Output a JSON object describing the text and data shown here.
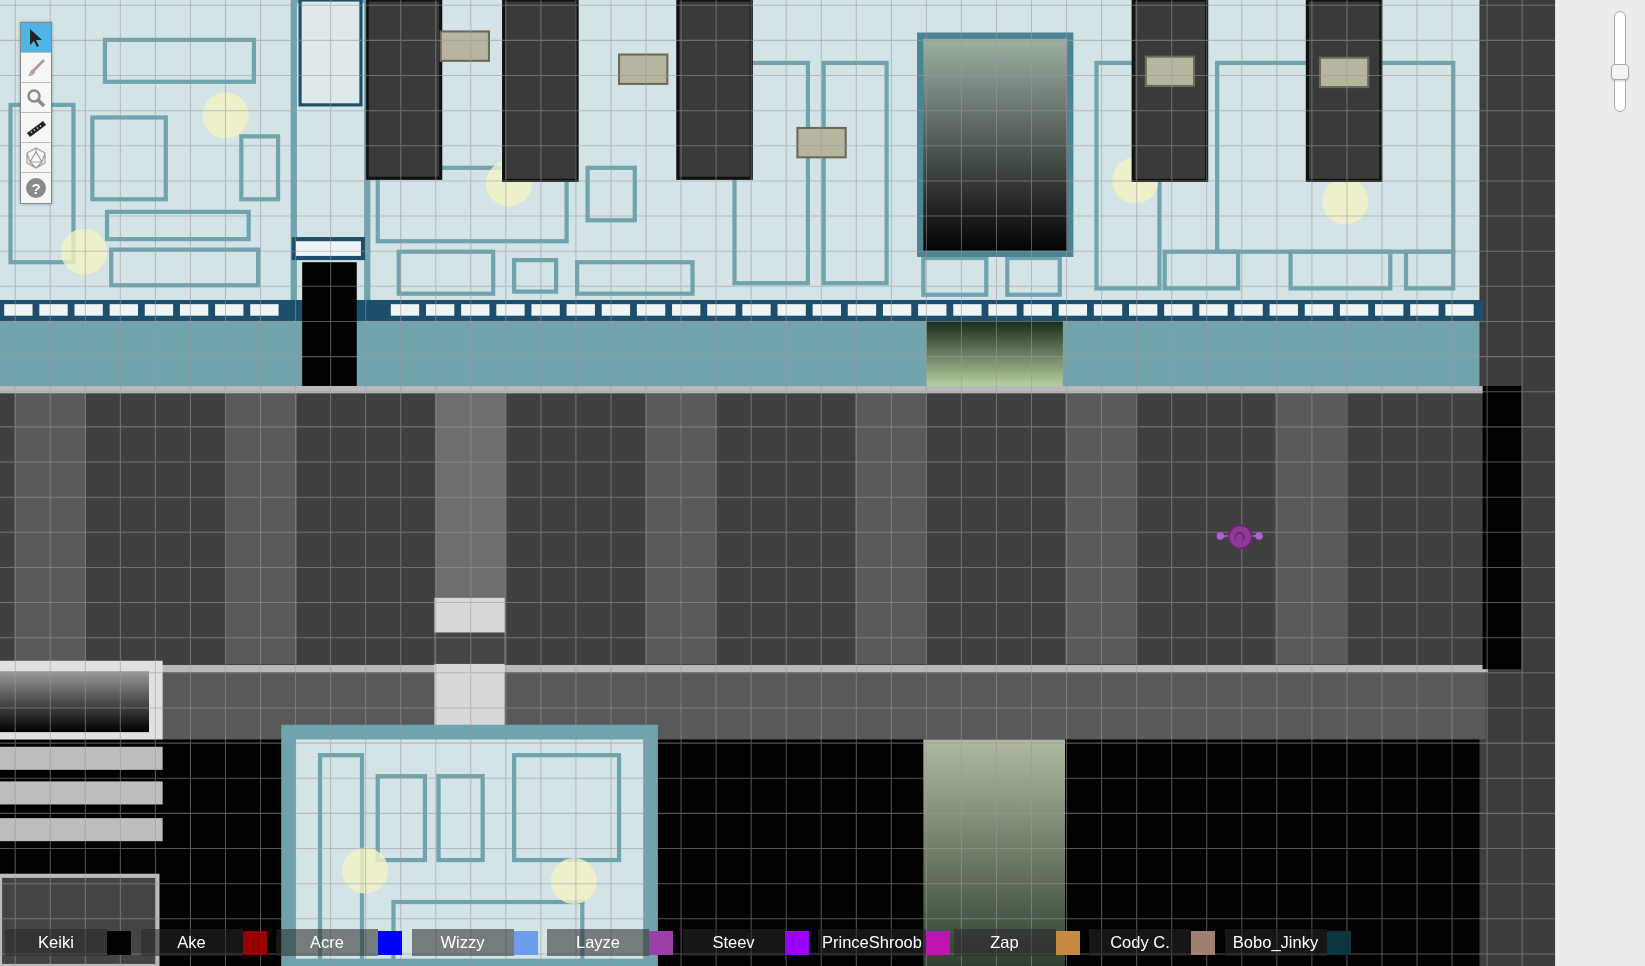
{
  "toolbar": {
    "tools": [
      {
        "kind": "select",
        "selected": true
      },
      {
        "kind": "draw",
        "selected": false
      },
      {
        "kind": "zoom",
        "selected": false
      },
      {
        "kind": "measure",
        "selected": false
      },
      {
        "kind": "dice",
        "selected": false
      },
      {
        "kind": "help",
        "selected": false,
        "glyph": "?"
      }
    ]
  },
  "players": [
    {
      "name": "Keiki",
      "color": "#000000"
    },
    {
      "name": "Ake",
      "color": "#990000"
    },
    {
      "name": "Acre",
      "color": "#0000ff"
    },
    {
      "name": "Wizzy",
      "color": "#6d9eeb"
    },
    {
      "name": "Layze",
      "color": "#9b3ea8"
    },
    {
      "name": "Steev",
      "color": "#9900ff"
    },
    {
      "name": "PrinceShroob",
      "color": "#c014b0"
    },
    {
      "name": "Zap",
      "color": "#c68b3e"
    },
    {
      "name": "Cody C.",
      "color": "#a07f6e"
    },
    {
      "name": "Bobo_Jinky",
      "color": "#0c3640"
    }
  ],
  "zoom_slider": {
    "level": 0.39
  }
}
